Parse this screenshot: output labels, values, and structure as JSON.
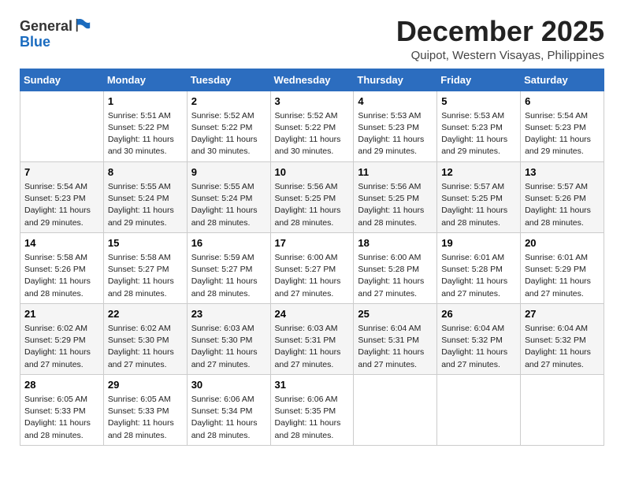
{
  "logo": {
    "text_general": "General",
    "text_blue": "Blue",
    "icon_shape": "flag"
  },
  "title": "December 2025",
  "subtitle": "Quipot, Western Visayas, Philippines",
  "calendar": {
    "headers": [
      "Sunday",
      "Monday",
      "Tuesday",
      "Wednesday",
      "Thursday",
      "Friday",
      "Saturday"
    ],
    "weeks": [
      [
        {
          "day": "",
          "sunrise": "",
          "sunset": "",
          "daylight": ""
        },
        {
          "day": "1",
          "sunrise": "Sunrise: 5:51 AM",
          "sunset": "Sunset: 5:22 PM",
          "daylight": "Daylight: 11 hours and 30 minutes."
        },
        {
          "day": "2",
          "sunrise": "Sunrise: 5:52 AM",
          "sunset": "Sunset: 5:22 PM",
          "daylight": "Daylight: 11 hours and 30 minutes."
        },
        {
          "day": "3",
          "sunrise": "Sunrise: 5:52 AM",
          "sunset": "Sunset: 5:22 PM",
          "daylight": "Daylight: 11 hours and 30 minutes."
        },
        {
          "day": "4",
          "sunrise": "Sunrise: 5:53 AM",
          "sunset": "Sunset: 5:23 PM",
          "daylight": "Daylight: 11 hours and 29 minutes."
        },
        {
          "day": "5",
          "sunrise": "Sunrise: 5:53 AM",
          "sunset": "Sunset: 5:23 PM",
          "daylight": "Daylight: 11 hours and 29 minutes."
        },
        {
          "day": "6",
          "sunrise": "Sunrise: 5:54 AM",
          "sunset": "Sunset: 5:23 PM",
          "daylight": "Daylight: 11 hours and 29 minutes."
        }
      ],
      [
        {
          "day": "7",
          "sunrise": "Sunrise: 5:54 AM",
          "sunset": "Sunset: 5:23 PM",
          "daylight": "Daylight: 11 hours and 29 minutes."
        },
        {
          "day": "8",
          "sunrise": "Sunrise: 5:55 AM",
          "sunset": "Sunset: 5:24 PM",
          "daylight": "Daylight: 11 hours and 29 minutes."
        },
        {
          "day": "9",
          "sunrise": "Sunrise: 5:55 AM",
          "sunset": "Sunset: 5:24 PM",
          "daylight": "Daylight: 11 hours and 28 minutes."
        },
        {
          "day": "10",
          "sunrise": "Sunrise: 5:56 AM",
          "sunset": "Sunset: 5:25 PM",
          "daylight": "Daylight: 11 hours and 28 minutes."
        },
        {
          "day": "11",
          "sunrise": "Sunrise: 5:56 AM",
          "sunset": "Sunset: 5:25 PM",
          "daylight": "Daylight: 11 hours and 28 minutes."
        },
        {
          "day": "12",
          "sunrise": "Sunrise: 5:57 AM",
          "sunset": "Sunset: 5:25 PM",
          "daylight": "Daylight: 11 hours and 28 minutes."
        },
        {
          "day": "13",
          "sunrise": "Sunrise: 5:57 AM",
          "sunset": "Sunset: 5:26 PM",
          "daylight": "Daylight: 11 hours and 28 minutes."
        }
      ],
      [
        {
          "day": "14",
          "sunrise": "Sunrise: 5:58 AM",
          "sunset": "Sunset: 5:26 PM",
          "daylight": "Daylight: 11 hours and 28 minutes."
        },
        {
          "day": "15",
          "sunrise": "Sunrise: 5:58 AM",
          "sunset": "Sunset: 5:27 PM",
          "daylight": "Daylight: 11 hours and 28 minutes."
        },
        {
          "day": "16",
          "sunrise": "Sunrise: 5:59 AM",
          "sunset": "Sunset: 5:27 PM",
          "daylight": "Daylight: 11 hours and 28 minutes."
        },
        {
          "day": "17",
          "sunrise": "Sunrise: 6:00 AM",
          "sunset": "Sunset: 5:27 PM",
          "daylight": "Daylight: 11 hours and 27 minutes."
        },
        {
          "day": "18",
          "sunrise": "Sunrise: 6:00 AM",
          "sunset": "Sunset: 5:28 PM",
          "daylight": "Daylight: 11 hours and 27 minutes."
        },
        {
          "day": "19",
          "sunrise": "Sunrise: 6:01 AM",
          "sunset": "Sunset: 5:28 PM",
          "daylight": "Daylight: 11 hours and 27 minutes."
        },
        {
          "day": "20",
          "sunrise": "Sunrise: 6:01 AM",
          "sunset": "Sunset: 5:29 PM",
          "daylight": "Daylight: 11 hours and 27 minutes."
        }
      ],
      [
        {
          "day": "21",
          "sunrise": "Sunrise: 6:02 AM",
          "sunset": "Sunset: 5:29 PM",
          "daylight": "Daylight: 11 hours and 27 minutes."
        },
        {
          "day": "22",
          "sunrise": "Sunrise: 6:02 AM",
          "sunset": "Sunset: 5:30 PM",
          "daylight": "Daylight: 11 hours and 27 minutes."
        },
        {
          "day": "23",
          "sunrise": "Sunrise: 6:03 AM",
          "sunset": "Sunset: 5:30 PM",
          "daylight": "Daylight: 11 hours and 27 minutes."
        },
        {
          "day": "24",
          "sunrise": "Sunrise: 6:03 AM",
          "sunset": "Sunset: 5:31 PM",
          "daylight": "Daylight: 11 hours and 27 minutes."
        },
        {
          "day": "25",
          "sunrise": "Sunrise: 6:04 AM",
          "sunset": "Sunset: 5:31 PM",
          "daylight": "Daylight: 11 hours and 27 minutes."
        },
        {
          "day": "26",
          "sunrise": "Sunrise: 6:04 AM",
          "sunset": "Sunset: 5:32 PM",
          "daylight": "Daylight: 11 hours and 27 minutes."
        },
        {
          "day": "27",
          "sunrise": "Sunrise: 6:04 AM",
          "sunset": "Sunset: 5:32 PM",
          "daylight": "Daylight: 11 hours and 27 minutes."
        }
      ],
      [
        {
          "day": "28",
          "sunrise": "Sunrise: 6:05 AM",
          "sunset": "Sunset: 5:33 PM",
          "daylight": "Daylight: 11 hours and 28 minutes."
        },
        {
          "day": "29",
          "sunrise": "Sunrise: 6:05 AM",
          "sunset": "Sunset: 5:33 PM",
          "daylight": "Daylight: 11 hours and 28 minutes."
        },
        {
          "day": "30",
          "sunrise": "Sunrise: 6:06 AM",
          "sunset": "Sunset: 5:34 PM",
          "daylight": "Daylight: 11 hours and 28 minutes."
        },
        {
          "day": "31",
          "sunrise": "Sunrise: 6:06 AM",
          "sunset": "Sunset: 5:35 PM",
          "daylight": "Daylight: 11 hours and 28 minutes."
        },
        {
          "day": "",
          "sunrise": "",
          "sunset": "",
          "daylight": ""
        },
        {
          "day": "",
          "sunrise": "",
          "sunset": "",
          "daylight": ""
        },
        {
          "day": "",
          "sunrise": "",
          "sunset": "",
          "daylight": ""
        }
      ]
    ]
  }
}
